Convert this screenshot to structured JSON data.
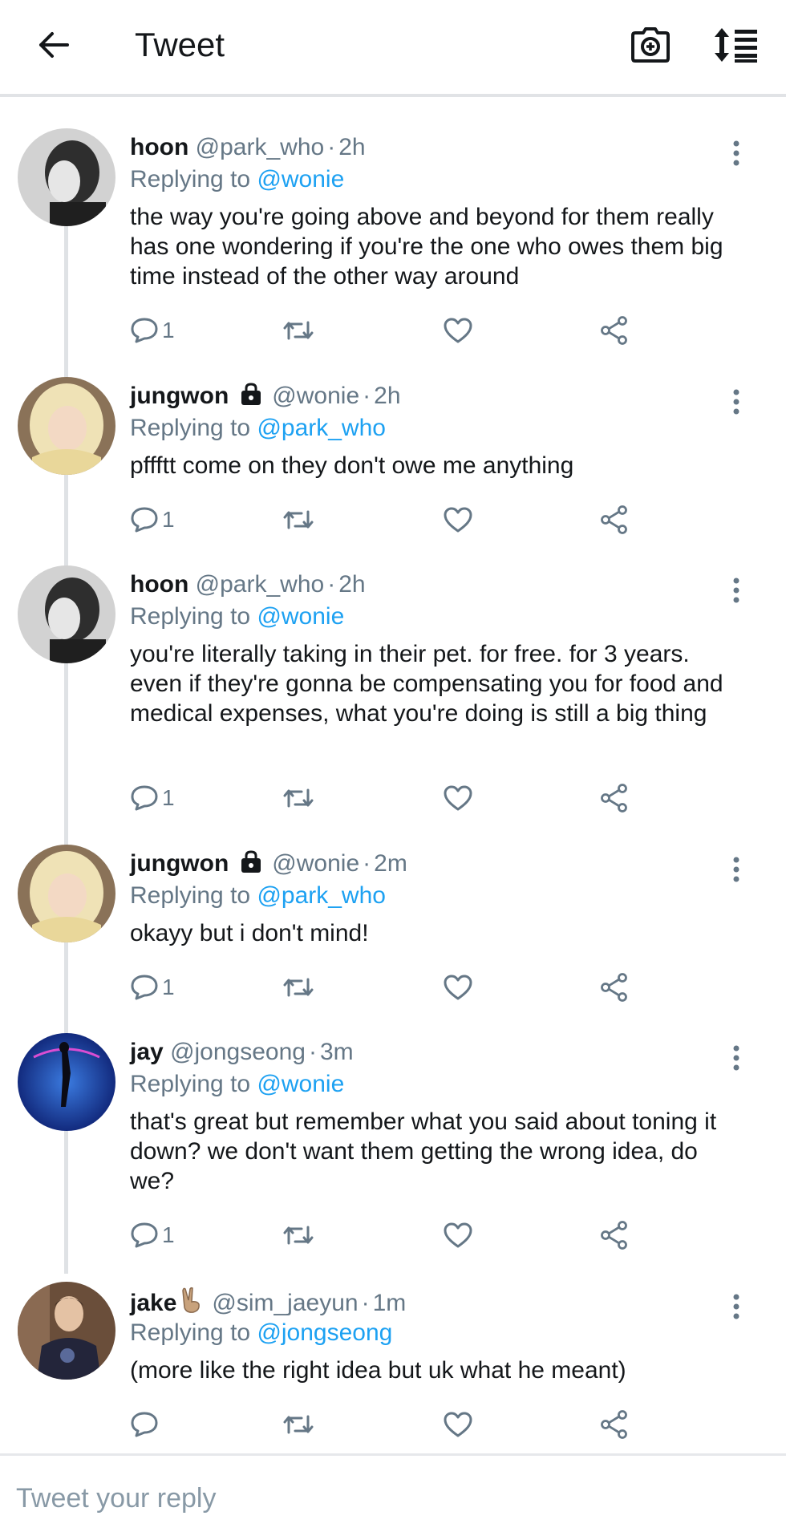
{
  "header": {
    "title": "Tweet",
    "back_icon": "arrow-left-icon",
    "camera_icon": "camera-add-icon",
    "sort_icon": "sort-list-icon"
  },
  "tweets": [
    {
      "name": "hoon",
      "handle": "@park_who",
      "time": "2h",
      "reply_prefix": "Replying to",
      "reply_to": "@wonie",
      "body": "the way you're going above and beyond for them really has one wondering if you're the one who owes them big time instead of the other way around",
      "reply_count": "1"
    },
    {
      "name": "jungwon",
      "handle": "@wonie",
      "time": "2h",
      "reply_prefix": "Replying to",
      "reply_to": "@park_who",
      "body": "pffftt come on they don't owe me anything",
      "reply_count": "1"
    },
    {
      "name": "hoon",
      "handle": "@park_who",
      "time": "2h",
      "reply_prefix": "Replying to",
      "reply_to": "@wonie",
      "body": "you're literally taking in their pet. for free. for 3 years. even if they're gonna be compensating you for food and medical expenses, what you're doing is still a big thing",
      "reply_count": "1"
    },
    {
      "name": "jungwon",
      "handle": "@wonie",
      "time": "2m",
      "reply_prefix": "Replying to",
      "reply_to": "@park_who",
      "body": "okayy but i don't mind!",
      "reply_count": "1"
    },
    {
      "name": "jay",
      "handle": "@jongseong",
      "time": "3m",
      "reply_prefix": "Replying to",
      "reply_to": "@wonie",
      "body": "that's great but remember what you said about toning it down? we don't want them getting the wrong idea, do we?",
      "reply_count": "1"
    },
    {
      "name": "jake",
      "handle": "@sim_jaeyun",
      "time": "1m",
      "reply_prefix": "Replying to",
      "reply_to": "@jongseong",
      "body": "(more like the right idea but uk what he meant)",
      "reply_count": ""
    }
  ],
  "compose": {
    "placeholder": "Tweet your reply"
  },
  "colors": {
    "accent": "#1da1f2",
    "secondary_text": "#657786",
    "primary_text": "#14171a"
  }
}
